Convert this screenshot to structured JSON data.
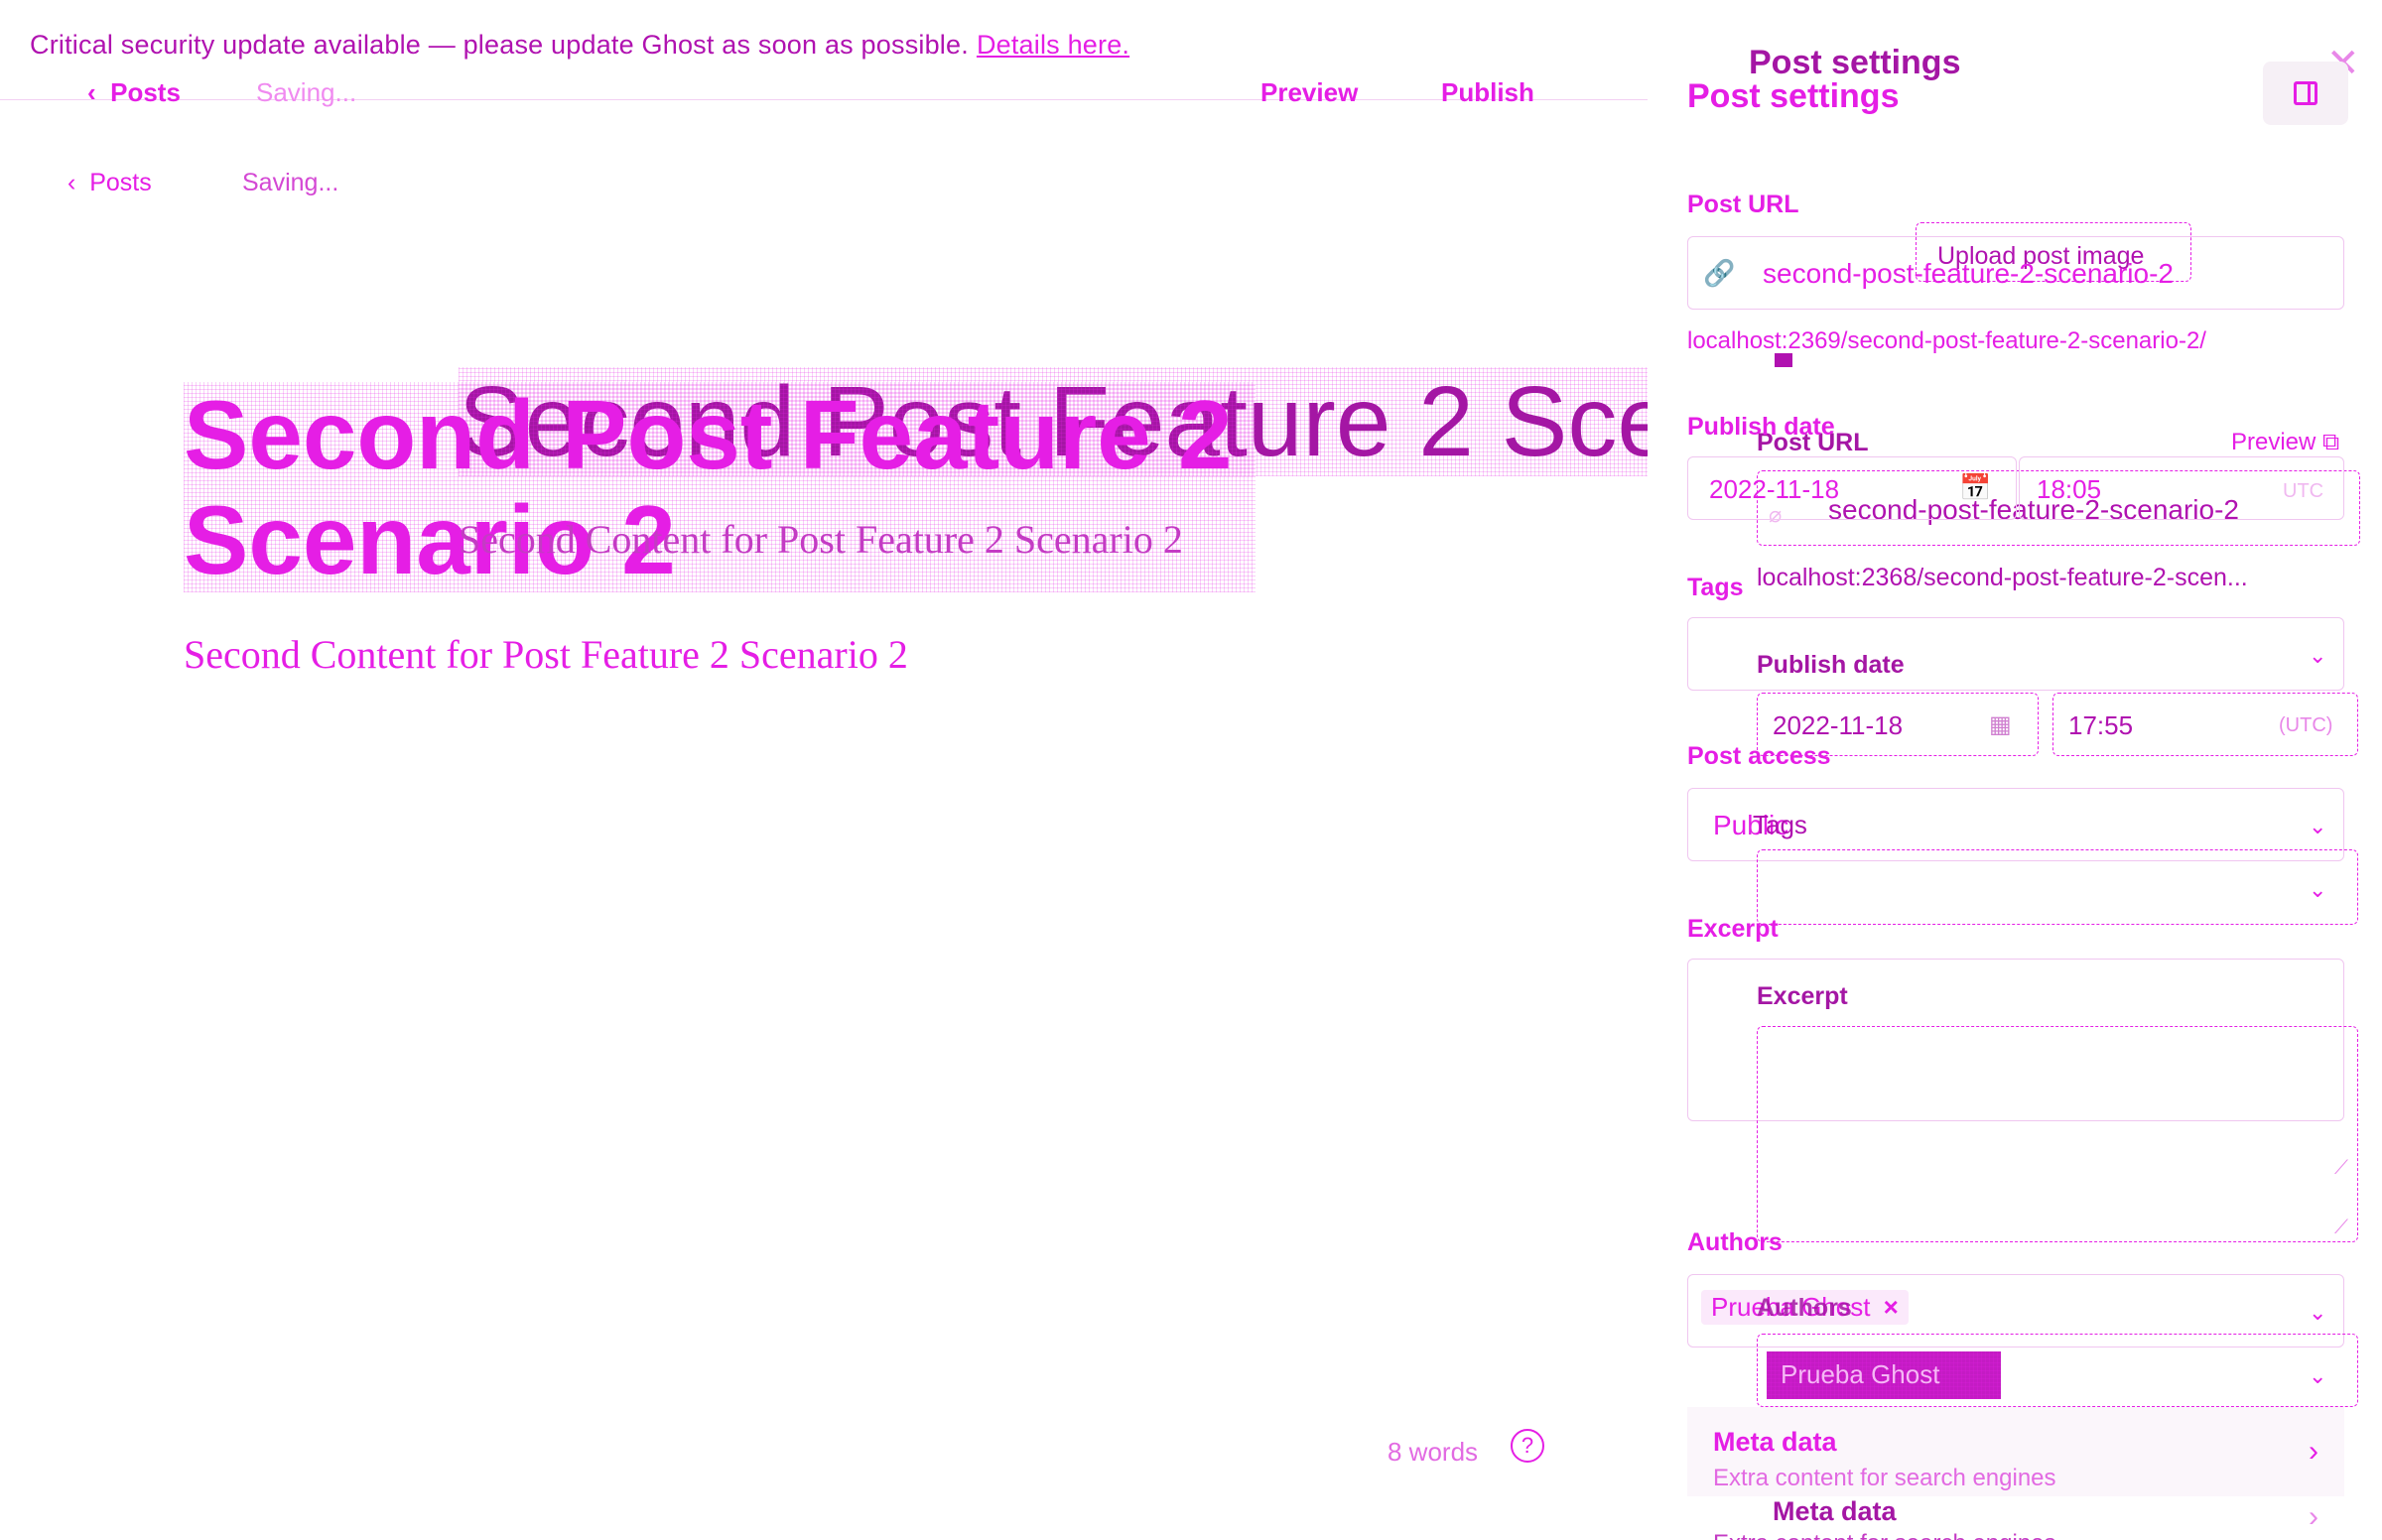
{
  "banner": {
    "text": "Critical security update available — please update Ghost as soon as possible.",
    "link": "Details here."
  },
  "ghost_nav": {
    "back": "Posts",
    "status": "Saving...",
    "preview": "Preview",
    "publish": "Publish"
  },
  "nav": {
    "back": "Posts",
    "status": "Saving..."
  },
  "editor": {
    "title": "Second Post Feature 2 Scenario 2",
    "ghost_title": "Second Post Feature 2 Scenario 2",
    "body": "Second Content for Post Feature 2 Scenario 2",
    "word_count": "8 words",
    "help": "?"
  },
  "sidebar": {
    "title": "Post settings",
    "ghost_title": "Post settings",
    "upload_image": "Upload post image",
    "post_url": {
      "label": "Post URL",
      "value": "second-post-feature-2-scenario-2",
      "full": "localhost:2369/second-post-feature-2-scenario-2/"
    },
    "ghost_post_url": {
      "label": "Post URL",
      "preview": "Preview",
      "value": "second-post-feature-2-scenario-2",
      "full": "localhost:2368/second-post-feature-2-scen..."
    },
    "publish_date": {
      "label": "Publish date",
      "date": "2022-11-18",
      "time": "18:05",
      "tz": "UTC"
    },
    "ghost_publish_date": {
      "label": "Publish date",
      "date": "2022-11-18",
      "time": "17:55",
      "tz": "(UTC)"
    },
    "tags": {
      "label": "Tags",
      "ghost_label": "Tags"
    },
    "post_access": {
      "label": "Post access",
      "value": "Public"
    },
    "excerpt": {
      "label": "Excerpt",
      "ghost_label": "Excerpt"
    },
    "authors": {
      "label": "Authors",
      "value": "Prueba Ghost",
      "ghost_label": "Authors",
      "ghost_value": "Prueba Ghost"
    },
    "meta_data": {
      "title": "Meta data",
      "desc": "Extra content for search engines",
      "ghost_title": "Meta data",
      "ghost_desc": "Extra content for search engines"
    }
  },
  "colors": {
    "accent": "#e51ee5",
    "accent_dark": "#b012b0"
  }
}
